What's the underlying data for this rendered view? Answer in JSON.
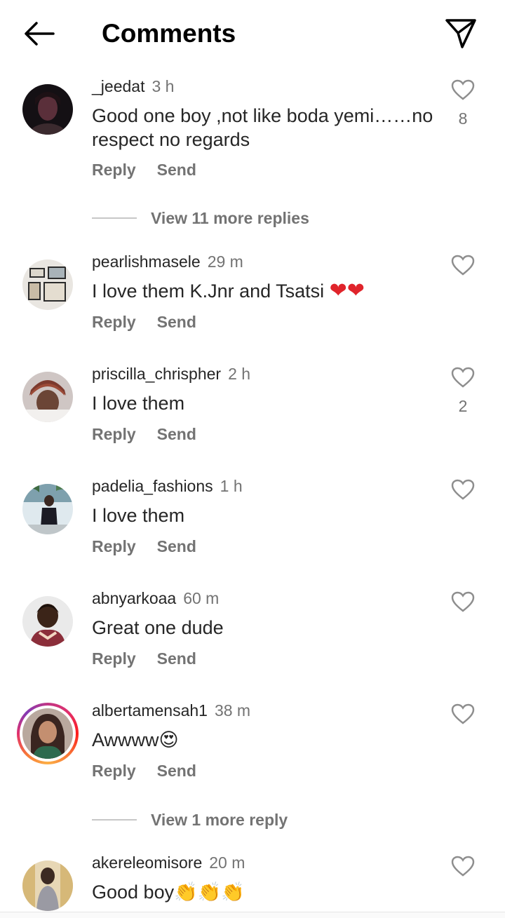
{
  "header": {
    "title": "Comments",
    "back_icon": "arrow-left-icon",
    "send_icon": "paper-plane-icon"
  },
  "labels": {
    "reply": "Reply",
    "send": "Send"
  },
  "comments": [
    {
      "username": "_jeedat",
      "time": "3 h",
      "text": "Good one boy ,not like boda yemi……no respect no regards",
      "likes": "8"
    },
    {
      "username": "pearlishmasele",
      "time": "29 m",
      "text": "I love them K.Jnr and Tsatsi ",
      "emoji": "❤❤",
      "likes": ""
    },
    {
      "username": "priscilla_chrispher",
      "time": "2 h",
      "text": "I love them",
      "likes": "2"
    },
    {
      "username": "padelia_fashions",
      "time": "1 h",
      "text": "I love them",
      "likes": ""
    },
    {
      "username": "abnyarkoaa",
      "time": "60 m",
      "text": "Great one dude",
      "likes": ""
    },
    {
      "username": "albertamensah1",
      "time": "38 m",
      "text": "Awwww",
      "emoji": "😍",
      "likes": ""
    },
    {
      "username": "akereleomisore",
      "time": "20 m",
      "text": "Good boy",
      "emoji": "👏👏👏",
      "likes": ""
    }
  ],
  "view_more": [
    {
      "label": "View 11 more replies"
    },
    {
      "label": "View 1 more reply"
    }
  ],
  "colors": {
    "text": "#262626",
    "muted": "#737373",
    "divider": "#c7c7c7"
  }
}
